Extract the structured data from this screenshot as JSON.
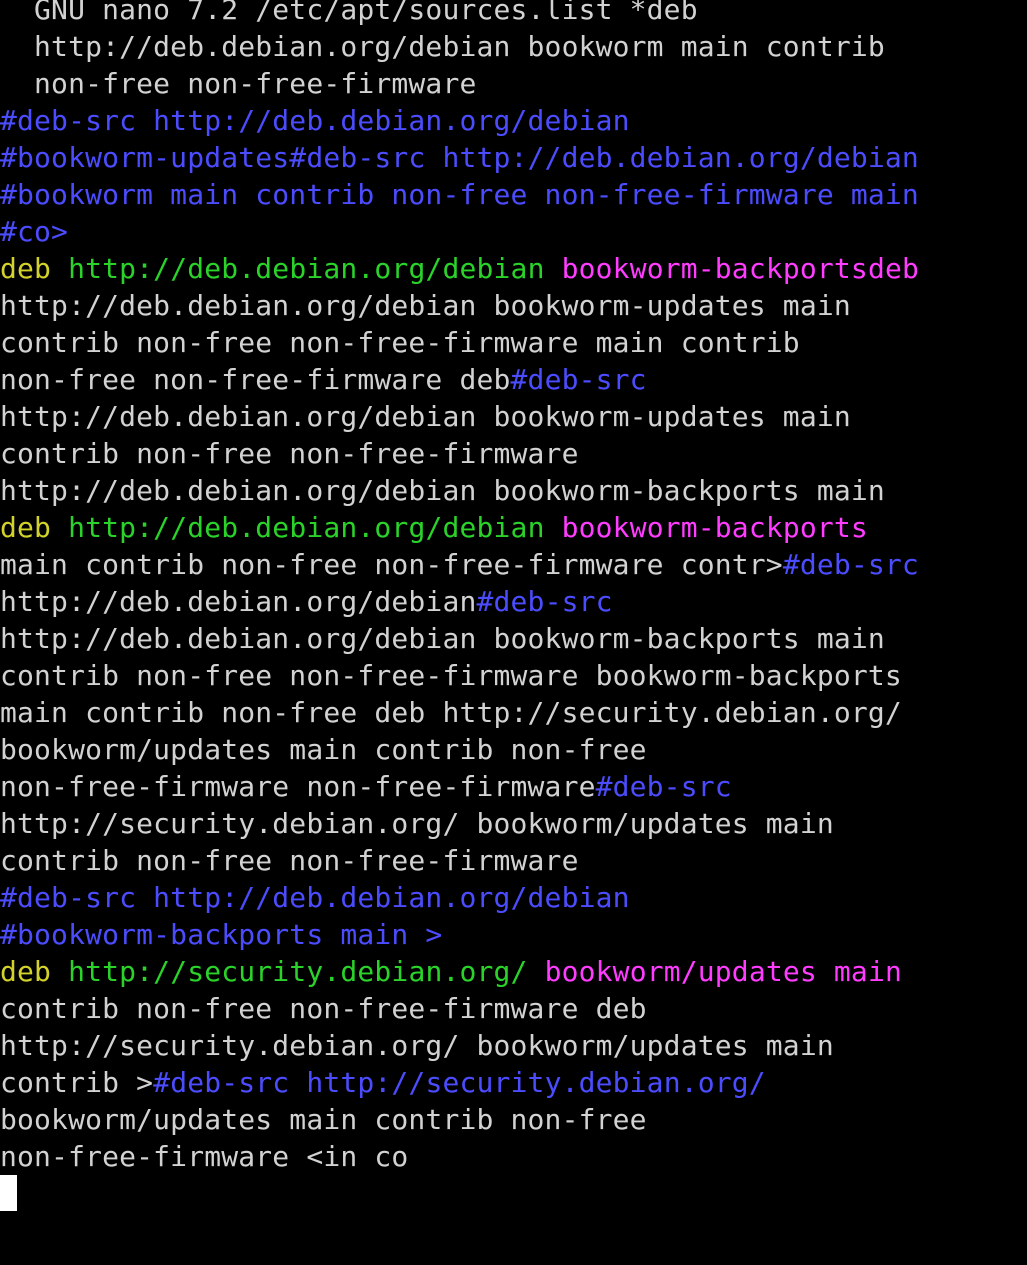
{
  "app": {
    "title": "GNU nano 7.2 /etc/apt/sources.list *deb"
  },
  "colors": {
    "background": "#000000",
    "text": "#d2d2d2",
    "comment": "#4c4cff",
    "keyword_deb": "#d2d22a",
    "url": "#2ad22a",
    "suite": "#ff3cff",
    "cursor": "#ffffff"
  },
  "editor": {
    "lines": [
      [
        {
          "t": "  GNU nano 7.2 /etc/apt/sources.list *deb",
          "c": "text"
        }
      ],
      [
        {
          "t": "  http://deb.debian.org/debian bookworm main contrib",
          "c": "text"
        }
      ],
      [
        {
          "t": "  non-free non-free-firmware",
          "c": "text"
        }
      ],
      [
        {
          "t": "#deb-src http://deb.debian.org/debian",
          "c": "comment"
        }
      ],
      [
        {
          "t": "#bookworm-updates#deb-src http://deb.debian.org/debian",
          "c": "comment"
        }
      ],
      [
        {
          "t": "#bookworm main contrib non-free non-free-firmware main",
          "c": "comment"
        }
      ],
      [
        {
          "t": "#co>",
          "c": "comment"
        }
      ],
      [
        {
          "t": "deb",
          "c": "keyword_deb"
        },
        {
          "t": " ",
          "c": "text"
        },
        {
          "t": "http://deb.debian.org/debian",
          "c": "url"
        },
        {
          "t": " ",
          "c": "text"
        },
        {
          "t": "bookworm-backportsdeb",
          "c": "suite"
        }
      ],
      [
        {
          "t": "http://deb.debian.org/debian bookworm-updates main",
          "c": "text"
        }
      ],
      [
        {
          "t": "contrib non-free non-free-firmware main contrib",
          "c": "text"
        }
      ],
      [
        {
          "t": "non-free non-free-firmware deb",
          "c": "text"
        },
        {
          "t": "#deb-src",
          "c": "comment"
        }
      ],
      [
        {
          "t": "http://deb.debian.org/debian bookworm-updates main",
          "c": "text"
        }
      ],
      [
        {
          "t": "contrib non-free non-free-firmware",
          "c": "text"
        }
      ],
      [
        {
          "t": "http://deb.debian.org/debian bookworm-backports main",
          "c": "text"
        }
      ],
      [
        {
          "t": "deb",
          "c": "keyword_deb"
        },
        {
          "t": " ",
          "c": "text"
        },
        {
          "t": "http://deb.debian.org/debian",
          "c": "url"
        },
        {
          "t": " ",
          "c": "text"
        },
        {
          "t": "bookworm-backports",
          "c": "suite"
        }
      ],
      [
        {
          "t": "main contrib non-free non-free-firmware contr>",
          "c": "text"
        },
        {
          "t": "#deb-src",
          "c": "comment"
        }
      ],
      [
        {
          "t": "http://deb.debian.org/debian",
          "c": "text"
        },
        {
          "t": "#deb-src",
          "c": "comment"
        }
      ],
      [
        {
          "t": "http://deb.debian.org/debian bookworm-backports main",
          "c": "text"
        }
      ],
      [
        {
          "t": "contrib non-free non-free-firmware bookworm-backports",
          "c": "text"
        }
      ],
      [
        {
          "t": "main contrib non-free deb http://security.debian.org/",
          "c": "text"
        }
      ],
      [
        {
          "t": "bookworm/updates main contrib non-free",
          "c": "text"
        }
      ],
      [
        {
          "t": "non-free-firmware non-free-firmware",
          "c": "text"
        },
        {
          "t": "#deb-src",
          "c": "comment"
        }
      ],
      [
        {
          "t": "http://security.debian.org/ bookworm/updates main",
          "c": "text"
        }
      ],
      [
        {
          "t": "contrib non-free non-free-firmware",
          "c": "text"
        }
      ],
      [
        {
          "t": "#deb-src http://deb.debian.org/debian",
          "c": "comment"
        }
      ],
      [
        {
          "t": "#bookworm-backports main >",
          "c": "comment"
        }
      ],
      [
        {
          "t": "deb",
          "c": "keyword_deb"
        },
        {
          "t": " ",
          "c": "text"
        },
        {
          "t": "http://security.debian.org/",
          "c": "url"
        },
        {
          "t": " ",
          "c": "text"
        },
        {
          "t": "bookworm/updates main",
          "c": "suite"
        }
      ],
      [
        {
          "t": "contrib non-free non-free-firmware deb",
          "c": "text"
        }
      ],
      [
        {
          "t": "http://security.debian.org/ bookworm/updates main",
          "c": "text"
        }
      ],
      [
        {
          "t": "contrib >",
          "c": "text"
        },
        {
          "t": "#deb-src http://security.debian.org/",
          "c": "comment"
        }
      ],
      [
        {
          "t": "bookworm/updates main contrib non-free",
          "c": "text"
        }
      ],
      [
        {
          "t": "non-free-firmware <in co",
          "c": "text"
        }
      ]
    ]
  }
}
